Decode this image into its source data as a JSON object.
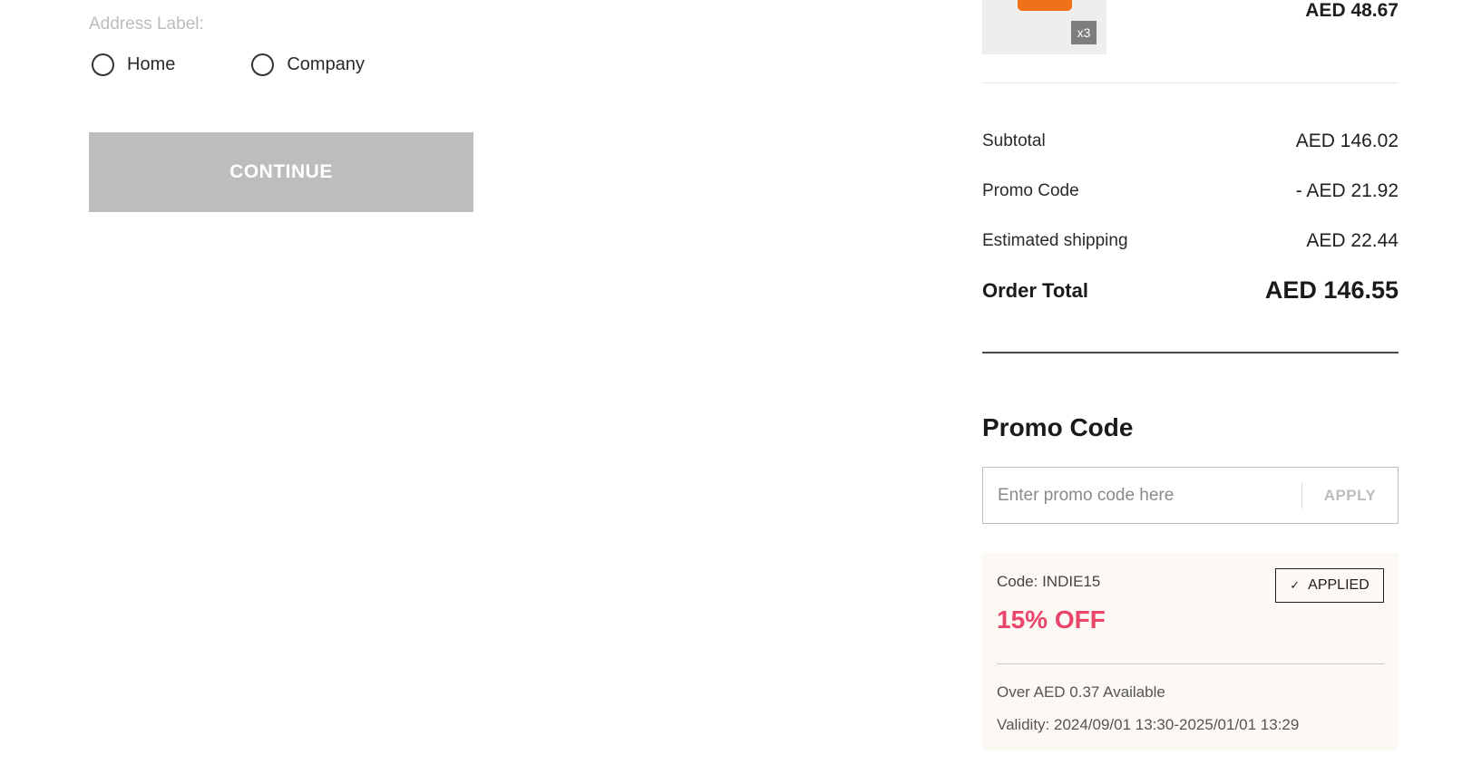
{
  "address": {
    "label": "Address Label:",
    "options": [
      {
        "label": "Home",
        "selected": false
      },
      {
        "label": "Company",
        "selected": false
      }
    ],
    "continue_label": "CONTINUE"
  },
  "cart_item": {
    "quantity_badge": "x3",
    "price": "AED 48.67",
    "thumb_color": "#f07218"
  },
  "summary": {
    "rows": [
      {
        "label": "Subtotal",
        "value": "AED 146.02"
      },
      {
        "label": "Promo Code",
        "value": "- AED 21.92"
      },
      {
        "label": "Estimated shipping",
        "value": "AED 22.44"
      }
    ],
    "total": {
      "label": "Order Total",
      "value": "AED 146.55"
    }
  },
  "promo": {
    "heading": "Promo Code",
    "input_placeholder": "Enter promo code here",
    "input_value": "",
    "apply_label": "APPLY"
  },
  "coupon": {
    "code": "Code: INDIE15",
    "discount": "15% OFF",
    "applied_label": "APPLIED",
    "check_icon": "check-icon",
    "threshold": "Over AED 0.37 Available",
    "validity": "Validity: 2024/09/01 13:30-2025/01/01 13:29",
    "accent_color": "#e8466a",
    "background_color": "#fcf8f3"
  },
  "colors": {
    "button_disabled": "#bdbdbd",
    "text_primary": "#1f1f1f"
  }
}
